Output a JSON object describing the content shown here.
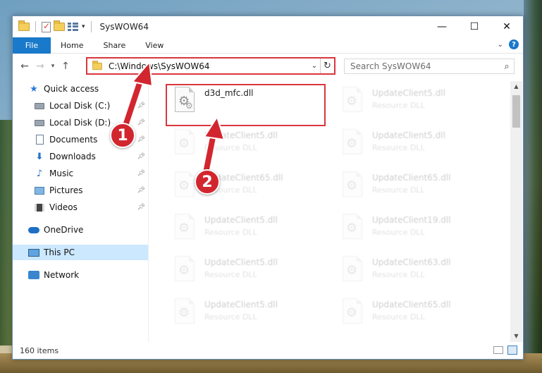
{
  "window": {
    "title": "SysWOW64",
    "controls": {
      "minimize": "—",
      "maximize": "☐",
      "close": "✕"
    }
  },
  "ribbon": {
    "file_tab": "File",
    "tabs": [
      "Home",
      "Share",
      "View"
    ],
    "help_label": "?"
  },
  "navbar": {
    "address_path": "C:\\Windows\\SysWOW64",
    "search_placeholder": "Search SysWOW64"
  },
  "sidebar": {
    "items": [
      {
        "label": "Quick access",
        "icon": "star-icon"
      },
      {
        "label": "Local Disk (C:)",
        "icon": "disk-icon",
        "pinned": true
      },
      {
        "label": "Local Disk (D:)",
        "icon": "disk-icon",
        "pinned": true
      },
      {
        "label": "Documents",
        "icon": "document-icon",
        "pinned": true
      },
      {
        "label": "Downloads",
        "icon": "download-icon",
        "pinned": true
      },
      {
        "label": "Music",
        "icon": "music-icon",
        "pinned": true
      },
      {
        "label": "Pictures",
        "icon": "picture-icon",
        "pinned": true
      },
      {
        "label": "Videos",
        "icon": "video-icon",
        "pinned": true
      },
      {
        "label": "OneDrive",
        "icon": "cloud-icon"
      },
      {
        "label": "This PC",
        "icon": "computer-icon",
        "selected": true
      },
      {
        "label": "Network",
        "icon": "network-icon"
      }
    ]
  },
  "files": [
    {
      "name": "d3d_mfc.dll",
      "type": "",
      "highlighted": true
    },
    {
      "name": "UpdateClient5.dll",
      "type": "Resource DLL"
    },
    {
      "name": "UpdateClient5.dll",
      "type": "Resource DLL"
    },
    {
      "name": "UpdateClient5.dll",
      "type": "Resource DLL"
    },
    {
      "name": "UpdateClient65.dll",
      "type": "Resource DLL"
    },
    {
      "name": "UpdateClient65.dll",
      "type": "Resource DLL"
    },
    {
      "name": "UpdateClient5.dll",
      "type": "Resource DLL"
    },
    {
      "name": "UpdateClient19.dll",
      "type": "Resource DLL"
    },
    {
      "name": "UpdateClient5.dll",
      "type": "Resource DLL"
    },
    {
      "name": "UpdateClient63.dll",
      "type": "Resource DLL"
    },
    {
      "name": "UpdateClient5.dll",
      "type": "Resource DLL"
    },
    {
      "name": "UpdateClient65.dll",
      "type": "Resource DLL"
    }
  ],
  "statusbar": {
    "item_count": "160 items"
  },
  "annotations": {
    "step1": "1",
    "step2": "2",
    "accent": "#d2262f"
  }
}
